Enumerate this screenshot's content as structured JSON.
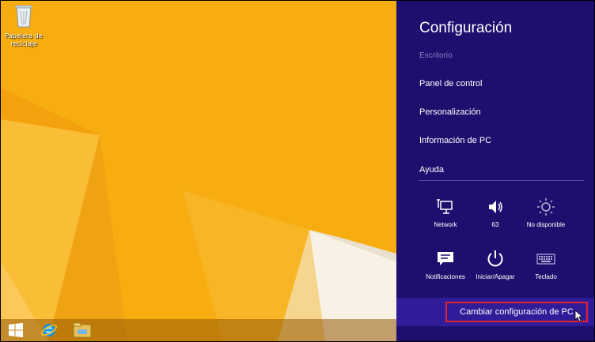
{
  "desktop": {
    "recycle_bin_label": "Papelera de reciclaje",
    "background_color": "#f7ad0f"
  },
  "taskbar": {
    "items": [
      {
        "name": "start-icon"
      },
      {
        "name": "internet-explorer-icon"
      },
      {
        "name": "file-explorer-icon"
      }
    ]
  },
  "charm": {
    "title": "Configuración",
    "subtitle": "Escritorio",
    "links": [
      "Panel de control",
      "Personalización",
      "Información de PC",
      "Ayuda"
    ],
    "tiles": [
      {
        "label": "Network",
        "icon": "network-icon"
      },
      {
        "label": "63",
        "icon": "volume-icon"
      },
      {
        "label": "No disponible",
        "icon": "brightness-icon"
      },
      {
        "label": "Notificaciones",
        "icon": "notifications-icon"
      },
      {
        "label": "Iniciar/Apagar",
        "icon": "power-icon"
      },
      {
        "label": "Teclado",
        "icon": "keyboard-icon"
      }
    ],
    "change_pc_settings": "Cambiar configuración de PC",
    "background_color": "#1e0f6e",
    "highlight_color": "#e8202a"
  }
}
